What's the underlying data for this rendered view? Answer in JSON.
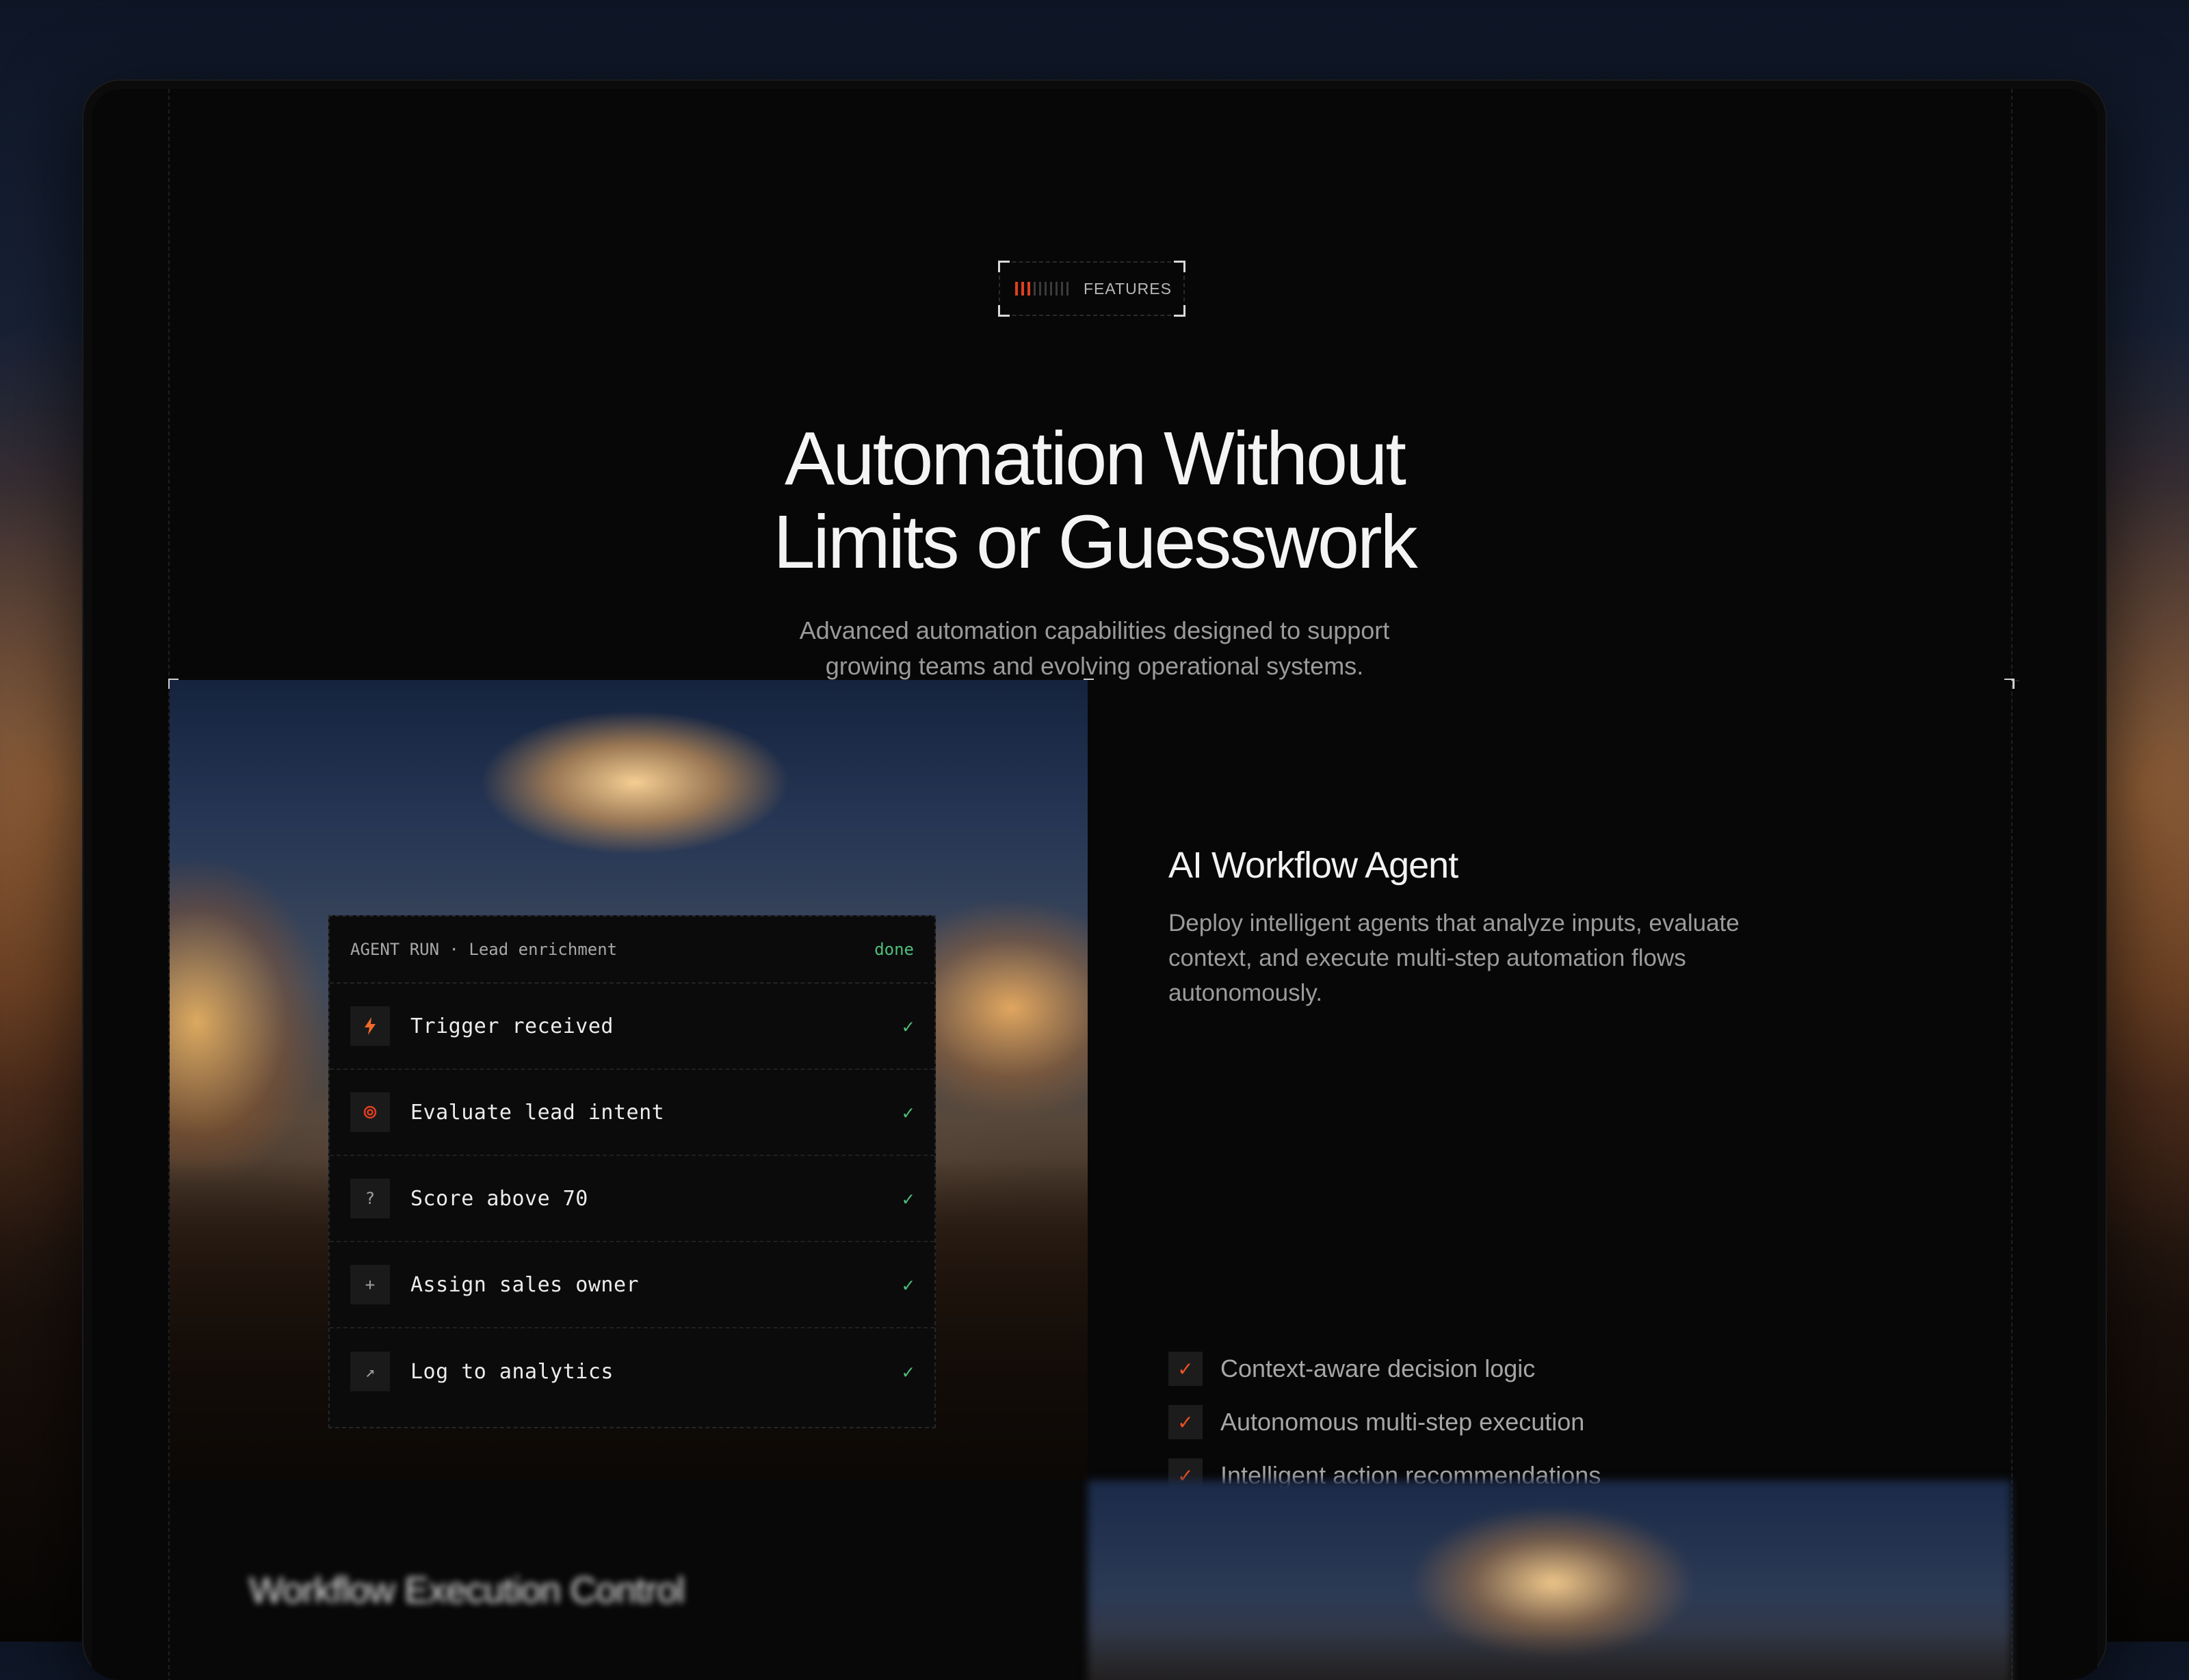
{
  "badge": {
    "label": "FEATURES"
  },
  "header": {
    "title_line1": "Automation Without",
    "title_line2": "Limits or Guesswork",
    "subtitle_line1": "Advanced automation capabilities designed to support",
    "subtitle_line2": "growing teams and evolving operational systems."
  },
  "agent_run": {
    "heading": "AGENT RUN · Lead enrichment",
    "status": "done",
    "steps": [
      {
        "label": "Trigger received",
        "icon": "bolt-icon",
        "check": "✓"
      },
      {
        "label": "Evaluate lead intent",
        "icon": "target-icon",
        "check": "✓"
      },
      {
        "label": "Score above 70",
        "icon": "question-icon",
        "check": "✓"
      },
      {
        "label": "Assign sales owner",
        "icon": "plus-icon",
        "check": "✓"
      },
      {
        "label": "Log to analytics",
        "icon": "arrow-up-right-icon",
        "check": "✓"
      }
    ]
  },
  "feature": {
    "title": "AI Workflow Agent",
    "description": "Deploy intelligent agents that analyze inputs, evaluate context, and execute multi-step automation flows autonomously.",
    "bullets": [
      "Context-aware decision logic",
      "Autonomous multi-step execution",
      "Intelligent action recommendations"
    ]
  },
  "next_feature": {
    "title": "Workflow Execution Control"
  },
  "colors": {
    "accent": "#e0401e",
    "success": "#4fbf7a",
    "background": "#070707"
  }
}
